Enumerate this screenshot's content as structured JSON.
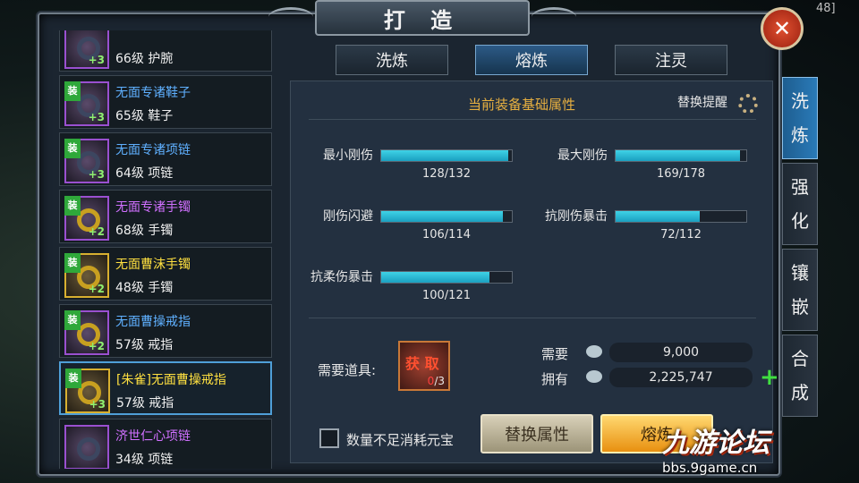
{
  "window": {
    "title": "打 造",
    "corner_num": "48]"
  },
  "list_items": [
    {
      "level": "66级 护腕",
      "name": "",
      "color": "blue",
      "plus": "+3",
      "tag": "",
      "frame": "purple"
    },
    {
      "level": "65级 鞋子",
      "name": "无面专诸鞋子",
      "color": "blue",
      "plus": "+3",
      "tag": "装",
      "frame": "purple"
    },
    {
      "level": "64级 项链",
      "name": "无面专诸项链",
      "color": "blue",
      "plus": "+3",
      "tag": "装",
      "frame": "purple"
    },
    {
      "level": "68级 手镯",
      "name": "无面专诸手镯",
      "color": "purple",
      "plus": "+2",
      "tag": "装",
      "frame": "purple"
    },
    {
      "level": "48级 手镯",
      "name": "无面曹沫手镯",
      "color": "yellow",
      "plus": "+2",
      "tag": "装",
      "frame": "gold"
    },
    {
      "level": "57级 戒指",
      "name": "无面曹操戒指",
      "color": "blue",
      "plus": "+2",
      "tag": "装",
      "frame": "purple"
    },
    {
      "level": "57级 戒指",
      "name": "[朱雀]无面曹操戒指",
      "color": "yellow",
      "plus": "+3",
      "tag": "装",
      "frame": "gold",
      "selected": true
    },
    {
      "level": "34级 项链",
      "name": "济世仁心项链",
      "color": "purple",
      "plus": "",
      "tag": "",
      "frame": "purple"
    }
  ],
  "top_tabs": [
    {
      "label": "洗炼",
      "active": false
    },
    {
      "label": "熔炼",
      "active": true
    },
    {
      "label": "注灵",
      "active": false
    }
  ],
  "panel": {
    "section_title": "当前装备基础属性",
    "swap_hint": "替换提醒",
    "stats": [
      {
        "label": "最小刚伤",
        "value": "128/132",
        "cur": 128,
        "max": 132
      },
      {
        "label": "最大刚伤",
        "value": "169/178",
        "cur": 169,
        "max": 178
      },
      {
        "label": "刚伤闪避",
        "value": "106/114",
        "cur": 106,
        "max": 114
      },
      {
        "label": "抗刚伤暴击",
        "value": "72/112",
        "cur": 72,
        "max": 112
      },
      {
        "label": "抗柔伤暴击",
        "value": "100/121",
        "cur": 100,
        "max": 121
      }
    ],
    "need_item_label": "需要道具:",
    "item_get": "获 取",
    "item_count_have": "0",
    "item_count_need": "/3",
    "need_label": "需要",
    "need_value": "9,000",
    "have_label": "拥有",
    "have_value": "2,225,747",
    "checkbox_label": "数量不足消耗元宝",
    "btn_swap": "替换属性",
    "btn_smelt": "熔炼"
  },
  "side_tabs": [
    {
      "label": "洗炼",
      "active": true
    },
    {
      "label": "强化",
      "active": false
    },
    {
      "label": "镶嵌",
      "active": false
    },
    {
      "label": "合成",
      "active": false
    }
  ],
  "watermark": {
    "brand": "九游论坛",
    "url": "bbs.9game.cn"
  },
  "colors": {
    "accent": "#2a7ab8",
    "bar": "#3fd2e6",
    "title": "#e8b040"
  }
}
